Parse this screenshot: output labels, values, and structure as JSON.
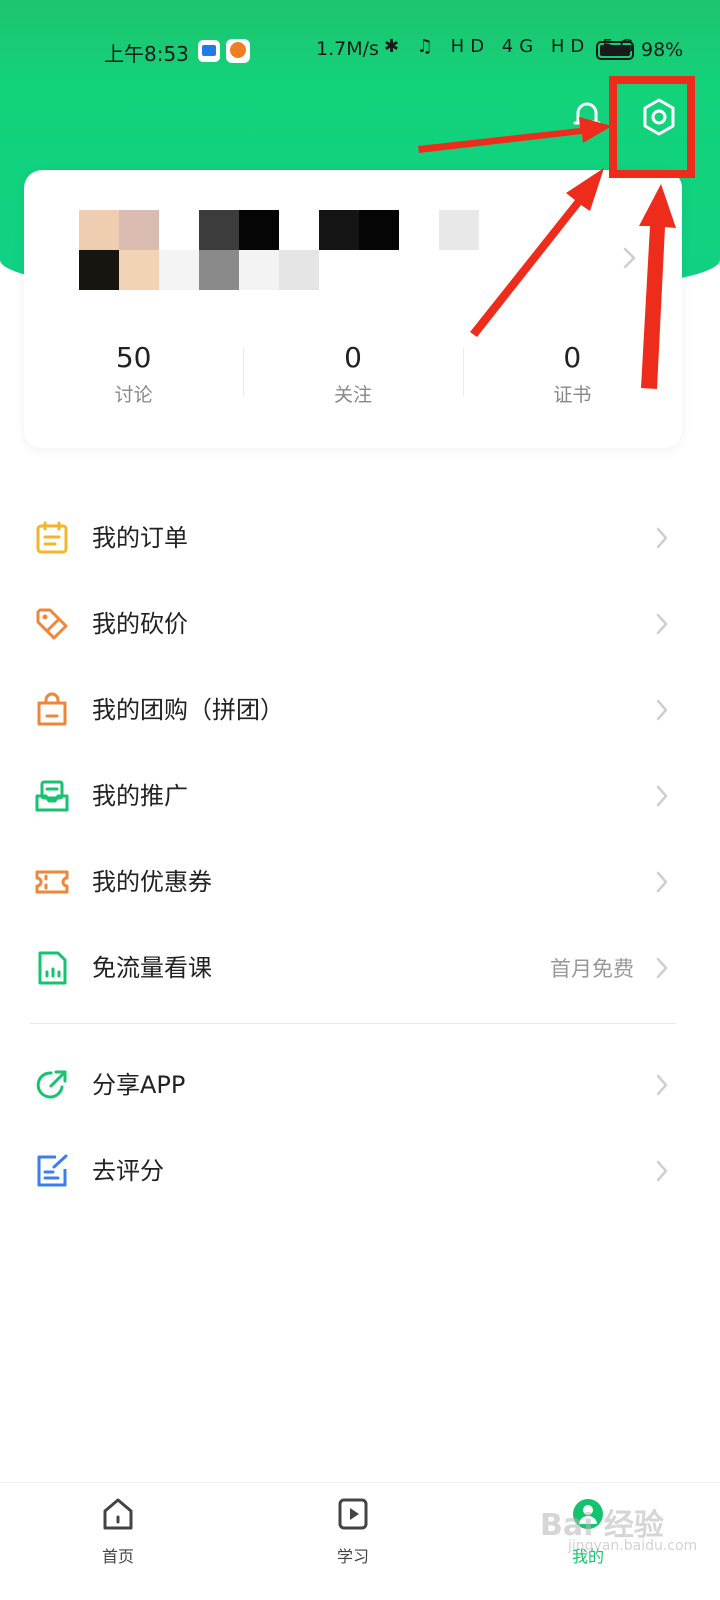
{
  "status_bar": {
    "time": "上午8:53",
    "speed": "1.7M/s",
    "icons": "✱ ♫ HD 4G HD 5G",
    "battery": "98%"
  },
  "profile": {
    "stats": [
      {
        "value": "50",
        "label": "讨论"
      },
      {
        "value": "0",
        "label": "关注"
      },
      {
        "value": "0",
        "label": "证书"
      }
    ]
  },
  "menu": [
    {
      "icon": "order-calendar-icon",
      "label": "我的订单",
      "color": "#f2b52b"
    },
    {
      "icon": "bargain-tag-icon",
      "label": "我的砍价",
      "color": "#f0863a"
    },
    {
      "icon": "group-buy-bag-icon",
      "label": "我的团购（拼团）",
      "color": "#f0863a"
    },
    {
      "icon": "promotion-inbox-icon",
      "label": "我的推广",
      "color": "#17c36f"
    },
    {
      "icon": "coupon-ticket-icon",
      "label": "我的优惠券",
      "color": "#f0863a"
    },
    {
      "icon": "sim-card-icon",
      "label": "免流量看课",
      "extra": "首月免费",
      "color": "#17c36f"
    }
  ],
  "menu2": [
    {
      "icon": "share-icon",
      "label": "分享APP",
      "color": "#17c36f"
    },
    {
      "icon": "rate-edit-icon",
      "label": "去评分",
      "color": "#3b7ef0"
    }
  ],
  "tabs": [
    {
      "icon": "home-icon",
      "label": "首页"
    },
    {
      "icon": "play-icon",
      "label": "学习"
    },
    {
      "icon": "profile-icon",
      "label": "我的"
    }
  ],
  "watermark": {
    "text": "Bai 经验",
    "sub": "jingyan.baidu.com"
  },
  "colors": {
    "brand_green": "#14c36e",
    "annotation_red": "#ee2c1b"
  }
}
